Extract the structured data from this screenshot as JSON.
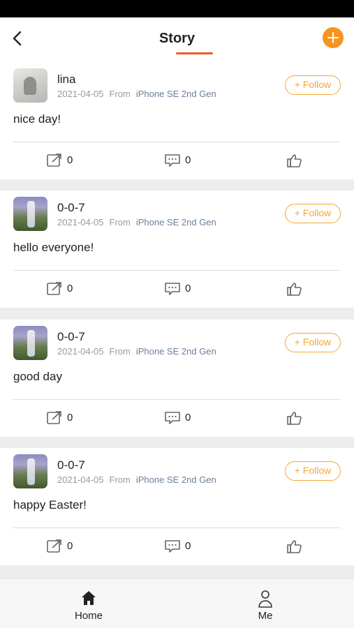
{
  "header": {
    "title": "Story",
    "accent_color": "#f05a28",
    "add_button_color": "#f7931e"
  },
  "posts": [
    {
      "username": "lina",
      "date": "2021-04-05",
      "from_label": "From",
      "device": "iPhone SE 2nd Gen",
      "follow_label": "+ Follow",
      "content": "nice day!",
      "share_count": "0",
      "comment_count": "0",
      "avatar": "stone-figure-avatar"
    },
    {
      "username": "0-0-7",
      "date": "2021-04-05",
      "from_label": "From",
      "device": "iPhone SE 2nd Gen",
      "follow_label": "+ Follow",
      "content": "hello everyone!",
      "share_count": "0",
      "comment_count": "0",
      "avatar": "waterfall-avatar"
    },
    {
      "username": "0-0-7",
      "date": "2021-04-05",
      "from_label": "From",
      "device": "iPhone SE 2nd Gen",
      "follow_label": "+ Follow",
      "content": "good day",
      "share_count": "0",
      "comment_count": "0",
      "avatar": "waterfall-avatar"
    },
    {
      "username": "0-0-7",
      "date": "2021-04-05",
      "from_label": "From",
      "device": "iPhone SE 2nd Gen",
      "follow_label": "+ Follow",
      "content": "happy Easter!",
      "share_count": "0",
      "comment_count": "0",
      "avatar": "waterfall-avatar"
    }
  ],
  "tabbar": {
    "home_label": "Home",
    "me_label": "Me"
  },
  "colors": {
    "follow": "#f7a632",
    "device_link": "#6b7f9a"
  }
}
